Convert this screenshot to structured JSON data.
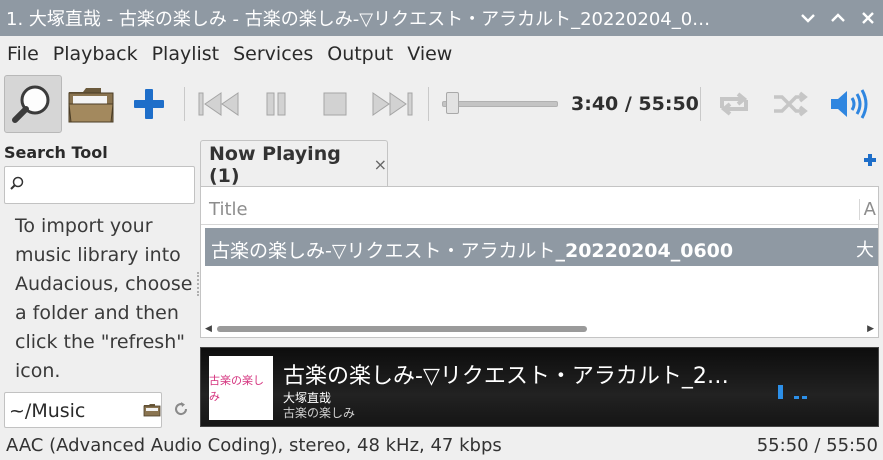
{
  "window": {
    "title": "1. 大塚直哉 - 古楽の楽しみ - 古楽の楽しみ-▽リクエスト・アラカルト_20220204_0…",
    "controls": [
      "chevron-down-icon",
      "chevron-up-icon",
      "close-icon"
    ]
  },
  "menu": {
    "items": [
      "File",
      "Playback",
      "Playlist",
      "Services",
      "Output",
      "View"
    ]
  },
  "toolbar": {
    "time": "3:40 / 55:50",
    "seek_fraction": 0.066,
    "buttons": [
      "search-tool-icon",
      "open-folder-icon",
      "add-icon",
      "previous-icon",
      "pause-icon",
      "stop-icon",
      "next-icon",
      "repeat-icon",
      "shuffle-icon",
      "volume-icon"
    ],
    "accent": "#1e6ec9"
  },
  "search_tool": {
    "title": "Search Tool",
    "placeholder": "",
    "help": "To import your music library into Audacious, choose a folder and then click the \"refresh\" icon.",
    "path": "~/Music"
  },
  "playlist": {
    "tab_label": "Now Playing (1)",
    "tab_close": "×",
    "columns": [
      "Title",
      "A"
    ],
    "rows": [
      {
        "title_prefix": "古楽の楽しみ-▽リクエスト・アラカルト",
        "title_bold": "_20220204_0600",
        "col2": "大"
      }
    ],
    "selection_color": "#8f99a3"
  },
  "now_playing": {
    "art_text": "古楽の楽しみ",
    "song": "古楽の楽しみ-▽リクエスト・アラカルト_2…",
    "artist": "大塚直哉",
    "album": "古楽の楽しみ"
  },
  "status": {
    "left": "AAC (Advanced Audio Coding), stereo, 48 kHz, 47 kbps",
    "right": "55:50 / 55:50"
  }
}
